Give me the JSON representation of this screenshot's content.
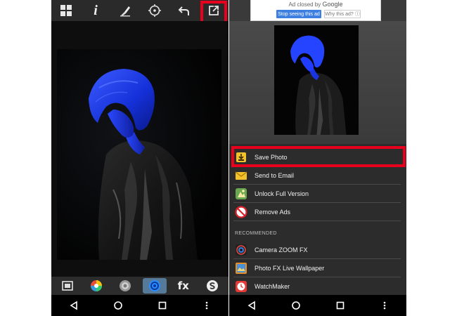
{
  "left_screen": {
    "toolbar": {
      "buttons": [
        {
          "name": "grid",
          "icon": "grid-icon"
        },
        {
          "name": "info",
          "icon": "info-icon",
          "glyph": "i"
        },
        {
          "name": "brush",
          "icon": "brush-icon"
        },
        {
          "name": "target",
          "icon": "target-icon"
        },
        {
          "name": "undo",
          "icon": "undo-icon"
        },
        {
          "name": "share",
          "icon": "share-icon"
        }
      ]
    },
    "fx_bar": {
      "fx_label": "fx",
      "buttons": [
        "crop-icon",
        "color-wheel-icon",
        "lens-icon",
        "circle-filter-icon",
        "fx-icon",
        "s-icon"
      ],
      "active_index": 3
    }
  },
  "right_screen": {
    "ad": {
      "closed_text": "Ad closed by",
      "brand": "Google",
      "stop_button": "Stop seeing this ad",
      "why_button": "Why this ad? ⓘ"
    },
    "menu": {
      "items": [
        {
          "label": "Save Photo",
          "icon": "save-photo-icon"
        },
        {
          "label": "Send to Email",
          "icon": "email-icon"
        },
        {
          "label": "Unlock Full Version",
          "icon": "unlock-icon"
        },
        {
          "label": "Remove Ads",
          "icon": "remove-ads-icon"
        }
      ],
      "section_label": "RECOMMENDED",
      "recommended": [
        {
          "label": "Camera ZOOM FX",
          "icon": "camera-zoom-fx-icon"
        },
        {
          "label": "Photo FX Live Wallpaper",
          "icon": "photo-fx-live-wallpaper-icon"
        },
        {
          "label": "WatchMaker",
          "icon": "watchmaker-icon"
        }
      ]
    }
  },
  "colors": {
    "highlight": "#e8001c",
    "blue_tint": "#1f3cff",
    "active_fx": "#557a9a"
  }
}
